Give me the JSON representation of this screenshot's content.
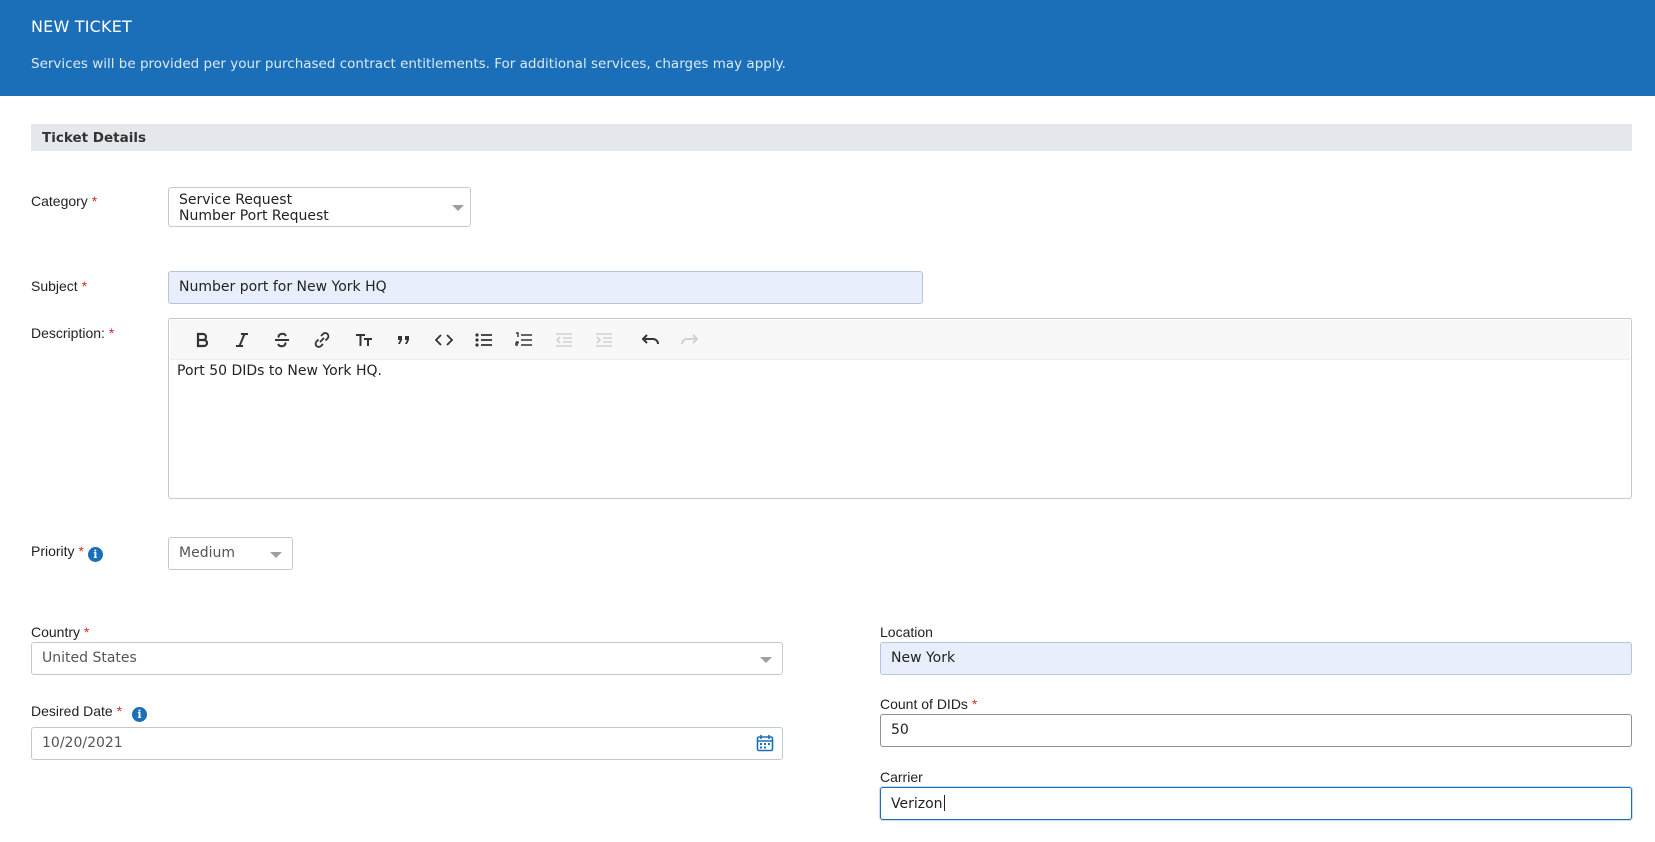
{
  "header": {
    "title": "NEW TICKET",
    "subtitle": "Services will be provided per your purchased contract entitlements. For additional services, charges may apply."
  },
  "section": {
    "title": "Ticket Details"
  },
  "form": {
    "required_mark": "*",
    "category": {
      "label": "Category",
      "line1": "Service Request",
      "line2": "Number Port Request"
    },
    "subject": {
      "label": "Subject",
      "value": "Number port for New York HQ"
    },
    "description": {
      "label": "Description:",
      "value": "Port 50 DIDs to New York HQ.",
      "toolbar": [
        "bold-icon",
        "italic-icon",
        "strikethrough-icon",
        "link-icon",
        "heading-icon",
        "quote-icon",
        "code-icon",
        "bullet-list-icon",
        "numbered-list-icon",
        "outdent-icon",
        "indent-icon",
        "undo-icon",
        "redo-icon"
      ]
    },
    "priority": {
      "label": "Priority",
      "value": "Medium"
    },
    "country": {
      "label": "Country",
      "value": "United States"
    },
    "desired_date": {
      "label": "Desired Date",
      "value": "10/20/2021"
    },
    "location": {
      "label": "Location",
      "value": "New York"
    },
    "count_dids": {
      "label": "Count of DIDs",
      "value": "50"
    },
    "carrier": {
      "label": "Carrier",
      "value": "Verizon"
    }
  },
  "colors": {
    "brand": "#1a6fb8",
    "required": "#c9302c",
    "filled_bg": "#e8eefb"
  }
}
